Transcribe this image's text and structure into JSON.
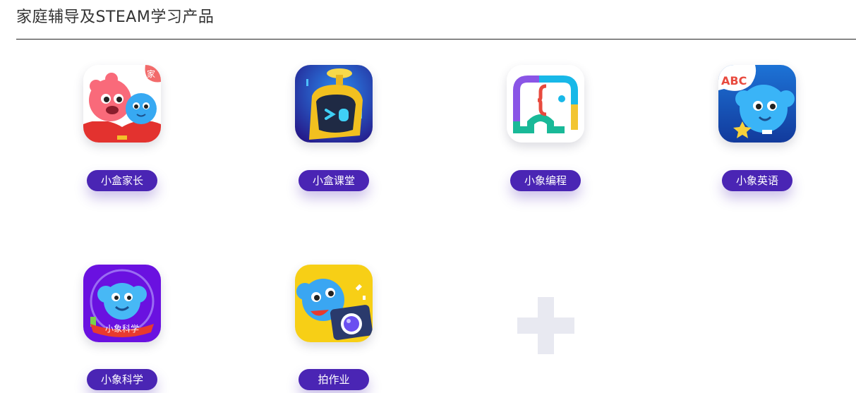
{
  "section": {
    "title": "家庭辅导及STEAM学习产品"
  },
  "products": [
    {
      "label": "小盒家长",
      "icon": "xiaohe-parent-app-icon",
      "badge": "家"
    },
    {
      "label": "小盒课堂",
      "icon": "xiaohe-classroom-robot-icon"
    },
    {
      "label": "小象编程",
      "icon": "xiaoxiang-coding-elephant-icon"
    },
    {
      "label": "小象英语",
      "icon": "xiaoxiang-english-abc-icon",
      "badge": "ABC"
    },
    {
      "label": "小象科学",
      "icon": "xiaoxiang-science-icon",
      "badge": "小象科学"
    },
    {
      "label": "拍作业",
      "icon": "photo-homework-camera-icon"
    }
  ],
  "add_more": {
    "icon": "plus-icon"
  },
  "colors": {
    "pill": "#4a25b4",
    "plus": "#e8e9f1",
    "title": "#333333"
  }
}
